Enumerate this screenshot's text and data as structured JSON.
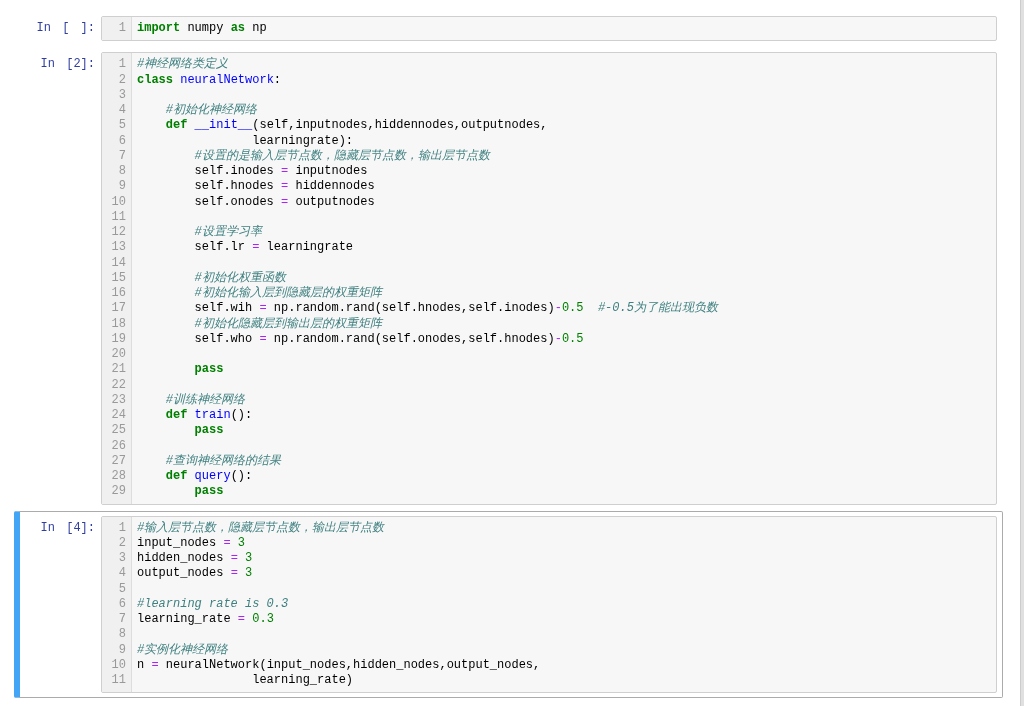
{
  "cells": [
    {
      "prompt": "In [ ]:",
      "selected": false,
      "lines": [
        {
          "number": "1",
          "tokens": [
            {
              "kind": "keyword",
              "text": "import"
            },
            {
              "kind": "plain",
              "text": " numpy "
            },
            {
              "kind": "keyword",
              "text": "as"
            },
            {
              "kind": "plain",
              "text": " np"
            }
          ]
        }
      ]
    },
    {
      "prompt": "In [2]:",
      "selected": false,
      "lines": [
        {
          "number": "1",
          "tokens": [
            {
              "kind": "comment",
              "text": "#神经网络类定义"
            }
          ]
        },
        {
          "number": "2",
          "tokens": [
            {
              "kind": "keyword",
              "text": "class"
            },
            {
              "kind": "name",
              "text": " neuralNetwork"
            },
            {
              "kind": "plain",
              "text": ":"
            }
          ]
        },
        {
          "number": "3"
        },
        {
          "number": "4",
          "tokens": [
            {
              "kind": "comment",
              "text": "    #初始化神经网络"
            }
          ]
        },
        {
          "number": "5",
          "tokens": [
            {
              "kind": "keyword",
              "text": "    def"
            },
            {
              "kind": "name",
              "text": " __init__"
            },
            {
              "kind": "plain",
              "text": "(self,inputnodes,hiddennodes,outputnodes,"
            }
          ]
        },
        {
          "number": "6",
          "tokens": [
            {
              "kind": "plain",
              "text": "                learningrate):"
            }
          ]
        },
        {
          "number": "7",
          "tokens": [
            {
              "kind": "comment",
              "text": "        #设置的是输入层节点数，隐藏层节点数，输出层节点数"
            }
          ]
        },
        {
          "number": "8",
          "tokens": [
            {
              "kind": "plain",
              "text": "        self.inodes "
            },
            {
              "kind": "operator",
              "text": "="
            },
            {
              "kind": "plain",
              "text": " inputnodes"
            }
          ]
        },
        {
          "number": "9",
          "tokens": [
            {
              "kind": "plain",
              "text": "        self.hnodes "
            },
            {
              "kind": "operator",
              "text": "="
            },
            {
              "kind": "plain",
              "text": " hiddennodes"
            }
          ]
        },
        {
          "number": "10",
          "tokens": [
            {
              "kind": "plain",
              "text": "        self.onodes "
            },
            {
              "kind": "operator",
              "text": "="
            },
            {
              "kind": "plain",
              "text": " outputnodes"
            }
          ]
        },
        {
          "number": "11"
        },
        {
          "number": "12",
          "tokens": [
            {
              "kind": "comment",
              "text": "        #设置学习率"
            }
          ]
        },
        {
          "number": "13",
          "tokens": [
            {
              "kind": "plain",
              "text": "        self.lr "
            },
            {
              "kind": "operator",
              "text": "="
            },
            {
              "kind": "plain",
              "text": " learningrate"
            }
          ]
        },
        {
          "number": "14"
        },
        {
          "number": "15",
          "tokens": [
            {
              "kind": "comment",
              "text": "        #初始化权重函数"
            }
          ]
        },
        {
          "number": "16",
          "tokens": [
            {
              "kind": "comment",
              "text": "        #初始化输入层到隐藏层的权重矩阵"
            }
          ]
        },
        {
          "number": "17",
          "tokens": [
            {
              "kind": "plain",
              "text": "        self.wih "
            },
            {
              "kind": "operator",
              "text": "="
            },
            {
              "kind": "plain",
              "text": " np.random.rand(self.hnodes,self.inodes)"
            },
            {
              "kind": "operator",
              "text": "-"
            },
            {
              "kind": "number",
              "text": "0.5"
            },
            {
              "kind": "comment",
              "text": "  #-0.5为了能出现负数"
            }
          ]
        },
        {
          "number": "18",
          "tokens": [
            {
              "kind": "comment",
              "text": "        #初始化隐藏层到输出层的权重矩阵"
            }
          ]
        },
        {
          "number": "19",
          "tokens": [
            {
              "kind": "plain",
              "text": "        self.who "
            },
            {
              "kind": "operator",
              "text": "="
            },
            {
              "kind": "plain",
              "text": " np.random.rand(self.onodes,self.hnodes)"
            },
            {
              "kind": "operator",
              "text": "-"
            },
            {
              "kind": "number",
              "text": "0.5"
            }
          ]
        },
        {
          "number": "20"
        },
        {
          "number": "21",
          "tokens": [
            {
              "kind": "keyword",
              "text": "        pass"
            }
          ]
        },
        {
          "number": "22"
        },
        {
          "number": "23",
          "tokens": [
            {
              "kind": "comment",
              "text": "    #训练神经网络"
            }
          ]
        },
        {
          "number": "24",
          "tokens": [
            {
              "kind": "keyword",
              "text": "    def"
            },
            {
              "kind": "name",
              "text": " train"
            },
            {
              "kind": "plain",
              "text": "():"
            }
          ]
        },
        {
          "number": "25",
          "tokens": [
            {
              "kind": "keyword",
              "text": "        pass"
            }
          ]
        },
        {
          "number": "26"
        },
        {
          "number": "27",
          "tokens": [
            {
              "kind": "comment",
              "text": "    #查询神经网络的结果"
            }
          ]
        },
        {
          "number": "28",
          "tokens": [
            {
              "kind": "keyword",
              "text": "    def"
            },
            {
              "kind": "name",
              "text": " query"
            },
            {
              "kind": "plain",
              "text": "():"
            }
          ]
        },
        {
          "number": "29",
          "tokens": [
            {
              "kind": "keyword",
              "text": "        pass"
            }
          ]
        }
      ]
    },
    {
      "prompt": "In [4]:",
      "selected": true,
      "lines": [
        {
          "number": "1",
          "tokens": [
            {
              "kind": "comment",
              "text": "#输入层节点数，隐藏层节点数，输出层节点数"
            }
          ]
        },
        {
          "number": "2",
          "tokens": [
            {
              "kind": "plain",
              "text": "input_nodes "
            },
            {
              "kind": "operator",
              "text": "="
            },
            {
              "kind": "number",
              "text": " 3"
            }
          ]
        },
        {
          "number": "3",
          "tokens": [
            {
              "kind": "plain",
              "text": "hidden_nodes "
            },
            {
              "kind": "operator",
              "text": "="
            },
            {
              "kind": "number",
              "text": " 3"
            }
          ]
        },
        {
          "number": "4",
          "tokens": [
            {
              "kind": "plain",
              "text": "output_nodes "
            },
            {
              "kind": "operator",
              "text": "="
            },
            {
              "kind": "number",
              "text": " 3"
            }
          ]
        },
        {
          "number": "5"
        },
        {
          "number": "6",
          "tokens": [
            {
              "kind": "comment",
              "text": "#learning rate is 0.3"
            }
          ]
        },
        {
          "number": "7",
          "tokens": [
            {
              "kind": "plain",
              "text": "learning_rate "
            },
            {
              "kind": "operator",
              "text": "="
            },
            {
              "kind": "number",
              "text": " 0.3"
            }
          ]
        },
        {
          "number": "8"
        },
        {
          "number": "9",
          "tokens": [
            {
              "kind": "comment",
              "text": "#实例化神经网络"
            }
          ]
        },
        {
          "number": "10",
          "tokens": [
            {
              "kind": "plain",
              "text": "n "
            },
            {
              "kind": "operator",
              "text": "="
            },
            {
              "kind": "plain",
              "text": " neuralNetwork(input_nodes,hidden_nodes,output_nodes,"
            }
          ]
        },
        {
          "number": "11",
          "tokens": [
            {
              "kind": "plain",
              "text": "                learning_rate)"
            }
          ]
        }
      ]
    }
  ]
}
